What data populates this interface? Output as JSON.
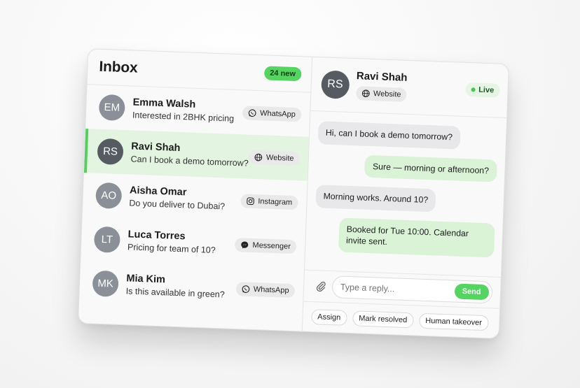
{
  "inbox": {
    "title": "Inbox",
    "new_badge": "24 new",
    "conversations": [
      {
        "initials": "EM",
        "name": "Emma Walsh",
        "preview": "Interested in 2BHK pricing",
        "channel": "WhatsApp",
        "channel_icon": "whatsapp-icon"
      },
      {
        "initials": "RS",
        "name": "Ravi Shah",
        "preview": "Can I book a demo tomorrow?",
        "channel": "Website",
        "channel_icon": "globe-icon"
      },
      {
        "initials": "AO",
        "name": "Aisha Omar",
        "preview": "Do you deliver to Dubai?",
        "channel": "Instagram",
        "channel_icon": "instagram-icon"
      },
      {
        "initials": "LT",
        "name": "Luca Torres",
        "preview": "Pricing for team of 10?",
        "channel": "Messenger",
        "channel_icon": "messenger-icon"
      },
      {
        "initials": "MK",
        "name": "Mia Kim",
        "preview": "Is this available in green?",
        "channel": "WhatsApp",
        "channel_icon": "whatsapp-icon"
      }
    ]
  },
  "chat": {
    "initials": "RS",
    "name": "Ravi Shah",
    "channel": "Website",
    "status": "Live",
    "messages": [
      {
        "direction": "in",
        "text": "Hi, can I book a demo tomorrow?"
      },
      {
        "direction": "out",
        "text": "Sure — morning or afternoon?"
      },
      {
        "direction": "in",
        "text": "Morning works. Around 10?"
      },
      {
        "direction": "out",
        "text": "Booked for Tue 10:00. Calendar invite sent."
      }
    ],
    "reply_placeholder": "Type a reply...",
    "send_label": "Send",
    "actions": [
      "Assign",
      "Mark resolved",
      "Human takeover"
    ]
  },
  "colors": {
    "accent": "#55d462",
    "active_row": "#e3f4e0",
    "outgoing_bubble": "#daf3d6",
    "incoming_bubble": "#e8e8ea"
  }
}
